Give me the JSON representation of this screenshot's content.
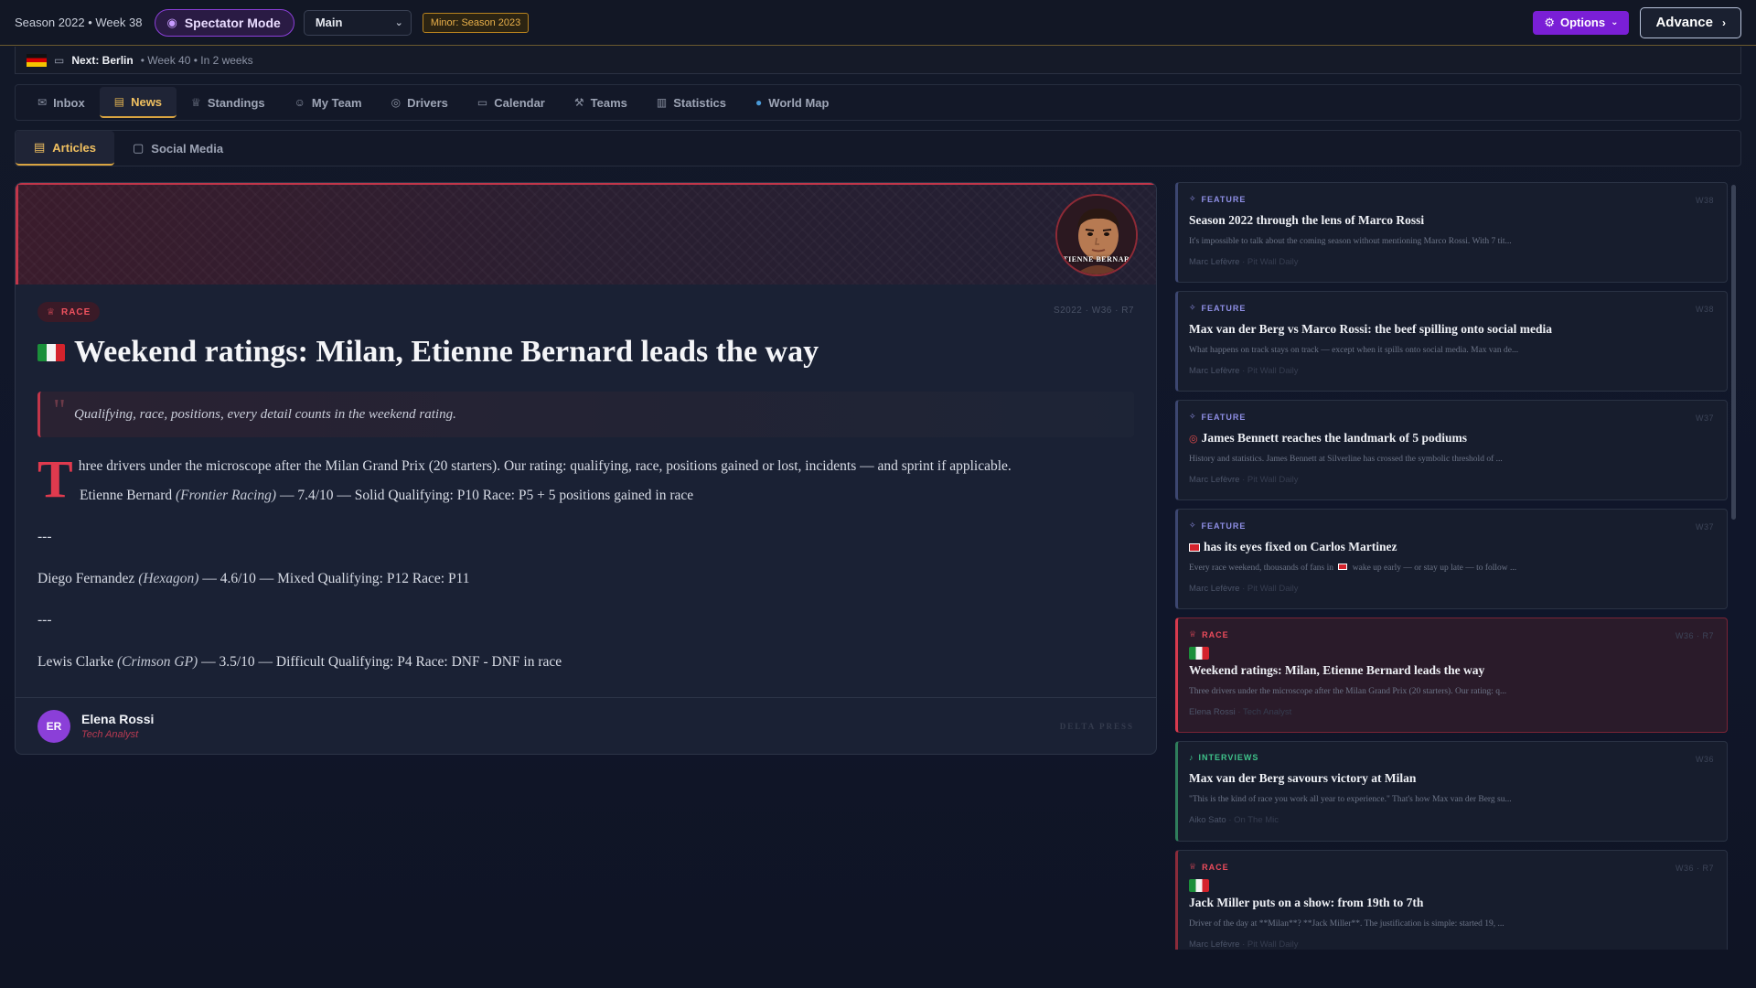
{
  "topbar": {
    "season_week": "Season 2022 • Week 38",
    "spectator_label": "Spectator Mode",
    "save_select": "Main",
    "minor_badge": "Minor: Season 2023",
    "options_label": "Options",
    "advance_label": "Advance"
  },
  "next_event": {
    "city": "Next: Berlin",
    "when": "• Week 40 • In 2 weeks"
  },
  "nav": {
    "items": [
      {
        "label": "Inbox",
        "icon": "mail-icon"
      },
      {
        "label": "News",
        "icon": "newspaper-icon"
      },
      {
        "label": "Standings",
        "icon": "trophy-icon"
      },
      {
        "label": "My Team",
        "icon": "user-icon"
      },
      {
        "label": "Drivers",
        "icon": "eye-icon"
      },
      {
        "label": "Calendar",
        "icon": "calendar-icon"
      },
      {
        "label": "Teams",
        "icon": "wrench-icon"
      },
      {
        "label": "Statistics",
        "icon": "bar-chart-icon"
      },
      {
        "label": "World Map",
        "icon": "globe-icon"
      }
    ],
    "active": "News"
  },
  "subnav": {
    "articles_label": "Articles",
    "social_label": "Social Media"
  },
  "article": {
    "avatar_name": "ETIENNE BERNARD",
    "category": "RACE",
    "meta": "S2022 · W36 · R7",
    "headline": "Weekend ratings: Milan, Etienne Bernard leads the way",
    "quote": "Qualifying, race, positions, every detail counts in the weekend rating.",
    "dropcap": "T",
    "intro": "hree drivers under the microscope after the Milan Grand Prix (20 starters). Our rating: qualifying, race, positions gained or lost, incidents — and sprint if applicable.",
    "ratings": [
      {
        "driver": "Etienne Bernard",
        "team": "(Frontier Racing)",
        "text": "— 7.4/10 — Solid Qualifying: P10 Race: P5 + 5 positions gained in race"
      },
      {
        "driver": "Diego Fernandez",
        "team": "(Hexagon)",
        "text": "— 4.6/10 — Mixed Qualifying: P12 Race: P11"
      },
      {
        "driver": "Lewis Clarke",
        "team": "(Crimson GP)",
        "text": "— 3.5/10 — Difficult Qualifying: P4 Race: DNF - DNF in race"
      }
    ],
    "separator": "---",
    "author_initials": "ER",
    "author_name": "Elena Rossi",
    "author_role": "Tech Analyst",
    "press": "DELTA PRESS"
  },
  "news_list": [
    {
      "category": "FEATURE",
      "week": "W38",
      "title": "Season 2022 through the lens of Marco Rossi",
      "excerpt": "It's impossible to talk about the coming season without mentioning Marco Rossi. With 7 tit...",
      "author": "Marc Lefèvre",
      "source": "· Pit Wall Daily"
    },
    {
      "category": "FEATURE",
      "week": "W38",
      "title": "Max van der Berg vs Marco Rossi: the beef spilling onto social media",
      "excerpt": "What happens on track stays on track — except when it spills onto social media. Max van de...",
      "author": "Marc Lefèvre",
      "source": "· Pit Wall Daily"
    },
    {
      "category": "FEATURE",
      "week": "W37",
      "title": "James Bennett reaches the landmark of 5 podiums",
      "excerpt": "History and statistics. James Bennett at Silverline has crossed the symbolic threshold of ...",
      "author": "Marc Lefèvre",
      "source": "· Pit Wall Daily"
    },
    {
      "category": "FEATURE",
      "week": "W37",
      "title": "has its eyes fixed on Carlos Martinez",
      "excerpt_a": "Every race weekend, thousands of fans in",
      "excerpt_b": "wake up early — or stay up late — to follow ...",
      "author": "Marc Lefèvre",
      "source": "· Pit Wall Daily"
    },
    {
      "category": "RACE",
      "week": "W36 · R7",
      "title": "Weekend ratings: Milan, Etienne Bernard leads the way",
      "excerpt": "Three drivers under the microscope after the Milan Grand Prix (20 starters). Our rating: q...",
      "author": "Elena Rossi",
      "source": "· Tech Analyst"
    },
    {
      "category": "INTERVIEWS",
      "week": "W36",
      "title": "Max van der Berg savours victory at Milan",
      "excerpt": "\"This is the kind of race you work all year to experience.\" That's how Max van der Berg su...",
      "author": "Aiko Sato",
      "source": "· On The Mic"
    },
    {
      "category": "RACE",
      "week": "W36 · R7",
      "title": "Jack Miller puts on a show: from 19th to 7th",
      "excerpt": "Driver of the day at **Milan**? **Jack Miller**. The justification is simple: started 19, ...",
      "author": "Marc Lefèvre",
      "source": "· Pit Wall Daily"
    }
  ],
  "colors": {
    "accent_gold": "#d9a441",
    "race_red": "#d63a4e",
    "spectator_purple": "#8b3fd8",
    "interview_green": "#3fc38a"
  }
}
